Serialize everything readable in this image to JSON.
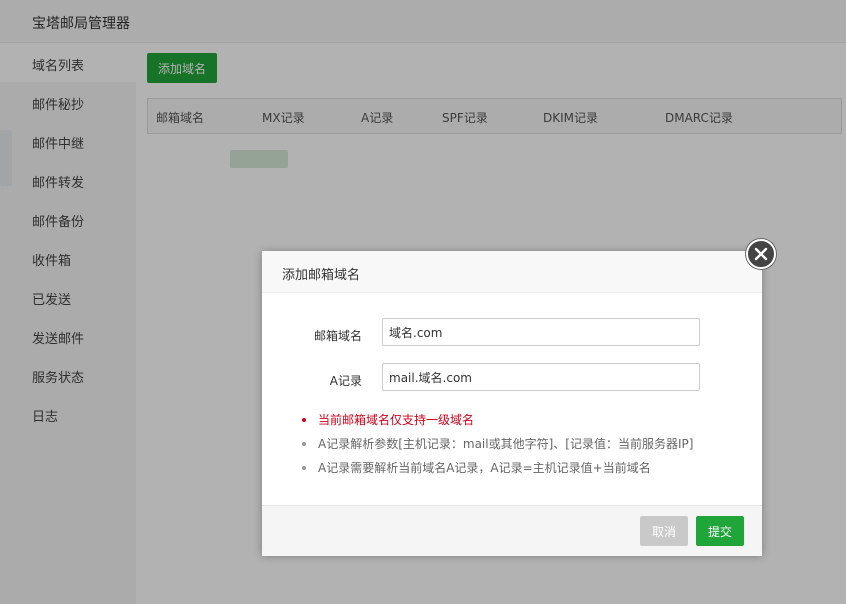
{
  "window": {
    "title": "宝塔邮局管理器"
  },
  "sidebar": {
    "items": [
      {
        "label": "域名列表"
      },
      {
        "label": "邮件秘抄"
      },
      {
        "label": "邮件中继"
      },
      {
        "label": "邮件转发"
      },
      {
        "label": "邮件备份"
      },
      {
        "label": "收件箱"
      },
      {
        "label": "已发送"
      },
      {
        "label": "发送邮件"
      },
      {
        "label": "服务状态"
      },
      {
        "label": "日志"
      }
    ]
  },
  "toolbar": {
    "add_domain_label": "添加域名"
  },
  "table": {
    "columns": [
      "邮箱域名",
      "MX记录",
      "A记录",
      "SPF记录",
      "DKIM记录",
      "DMARC记录"
    ]
  },
  "modal": {
    "title": "添加邮箱域名",
    "fields": {
      "domain": {
        "label": "邮箱域名",
        "value": "域名.com"
      },
      "a_record": {
        "label": "A记录",
        "value": "mail.域名.com"
      }
    },
    "tips": [
      "当前邮箱域名仅支持一级域名",
      "A记录解析参数[主机记录：mail或其他字符]、[记录值：当前服务器IP]",
      "A记录需要解析当前域名A记录，A记录=主机记录值+当前域名"
    ],
    "cancel_label": "取消",
    "submit_label": "提交"
  },
  "colors": {
    "accent": "#20a53a",
    "warning": "#d0021b"
  },
  "icons": {
    "close": "close-icon"
  }
}
